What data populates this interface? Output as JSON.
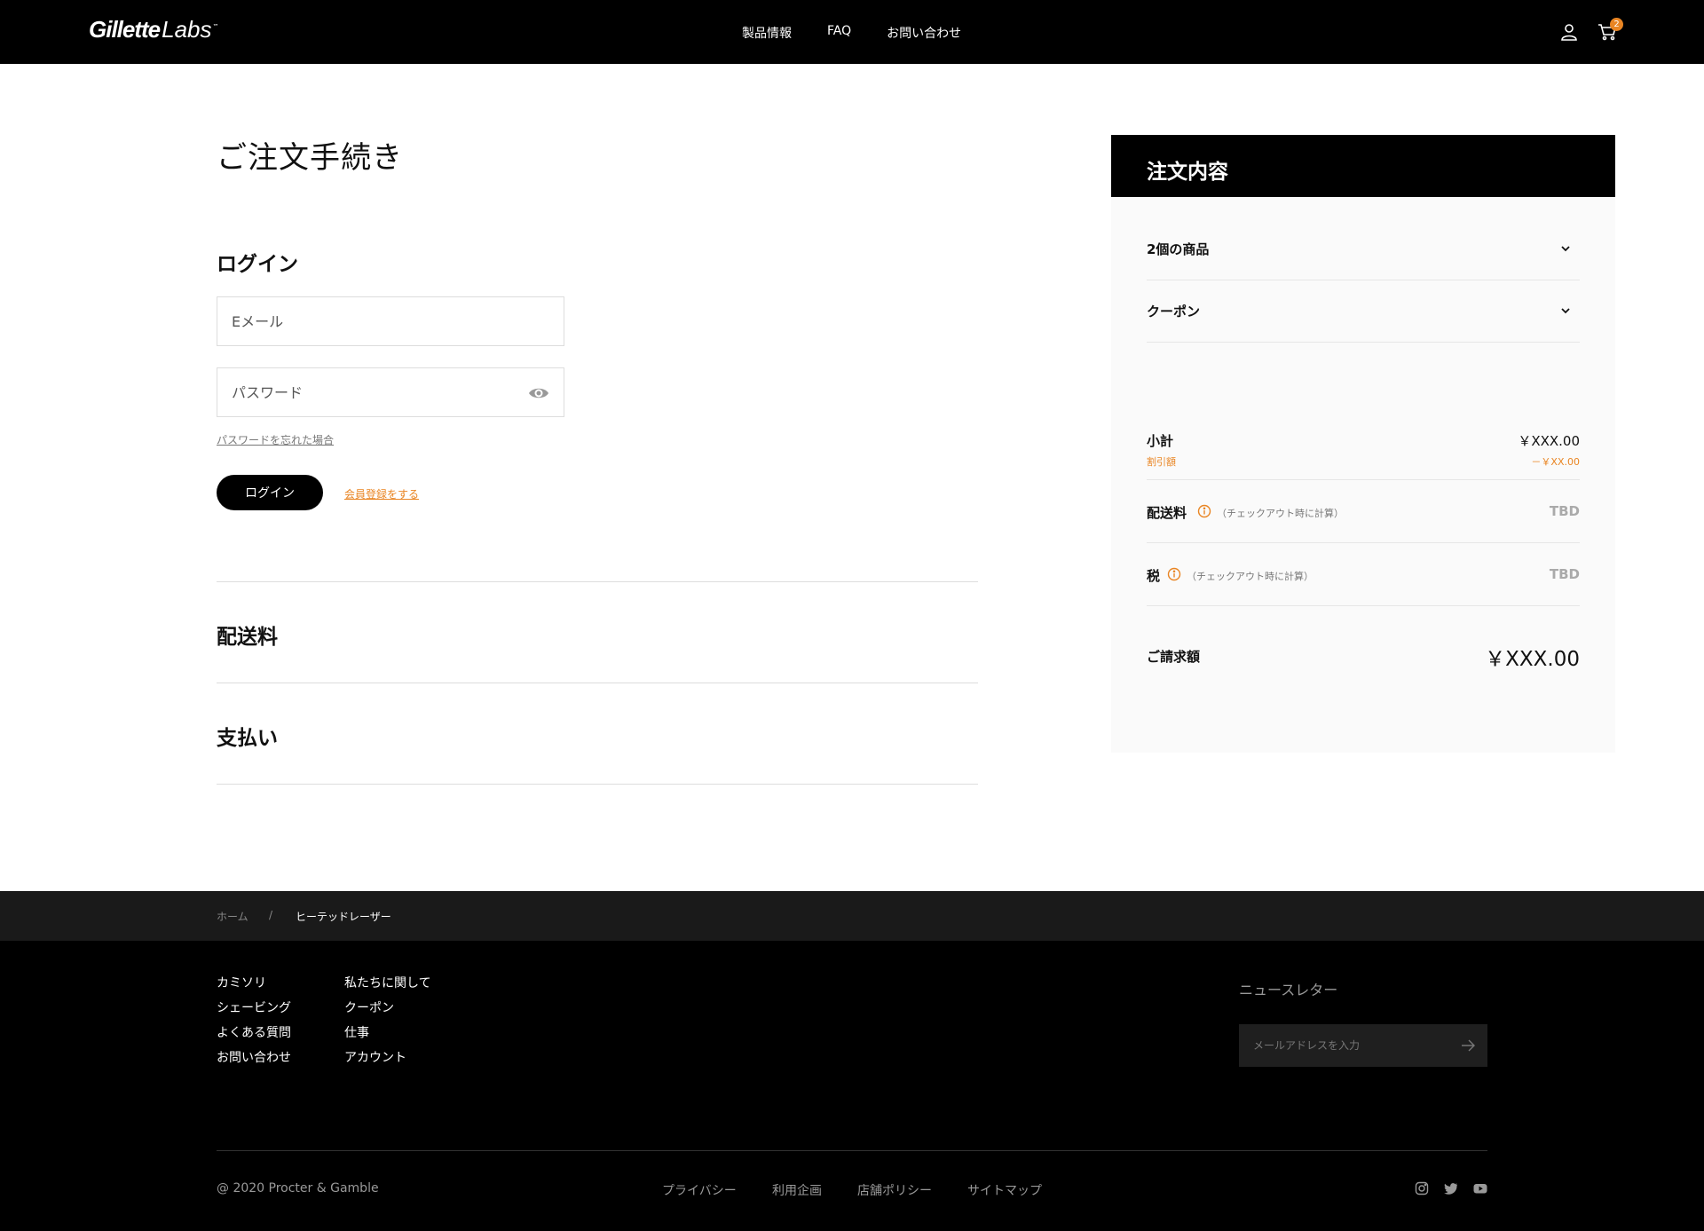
{
  "header": {
    "logo_bold": "Gillette",
    "logo_light": "Labs",
    "logo_tm": "™",
    "nav": [
      "製品情報",
      "FAQ",
      "お問い合わせ"
    ],
    "cart_count": "2",
    "badge_color": "#e98523"
  },
  "checkout": {
    "title": "ご注文手続き",
    "login": {
      "heading": "ログイン",
      "email_placeholder": "Eメール",
      "password_placeholder": "パスワード",
      "forgot": "パスワードを忘れた場合",
      "button": "ログイン",
      "register": "会員登録をする"
    },
    "shipping_heading": "配送料",
    "payment_heading": "支払い"
  },
  "summary": {
    "title": "注文内容",
    "items_label": "2個の商品",
    "coupon_label": "クーポン",
    "subtotal_label": "小計",
    "subtotal_value": "￥XXX.00",
    "discount_label": "割引額",
    "discount_value": "－￥XX.00",
    "shipping_label": "配送料",
    "shipping_note": "（チェックアウト時に計算）",
    "shipping_value": "TBD",
    "tax_label": "税",
    "tax_note": "（チェックアウト時に計算）",
    "tax_value": "TBD",
    "total_label": "ご請求額",
    "total_value": "￥XXX.00"
  },
  "breadcrumb": {
    "home": "ホーム",
    "separator": "/",
    "current": "ヒーテッドレーザー"
  },
  "footer": {
    "col1": [
      "カミソリ",
      "シェービング",
      "よくある質問",
      "お問い合わせ"
    ],
    "col2": [
      "私たちに関して",
      "クーポン",
      "仕事",
      "アカウント"
    ],
    "newsletter_title": "ニュースレター",
    "newsletter_placeholder": "メールアドレスを入力",
    "copyright": "@ 2020 Procter & Gamble",
    "legal": [
      "プライバシー",
      "利用企画",
      "店舗ポリシー",
      "サイトマップ"
    ],
    "social_icons": [
      "instagram-icon",
      "twitter-icon",
      "youtube-icon"
    ]
  }
}
